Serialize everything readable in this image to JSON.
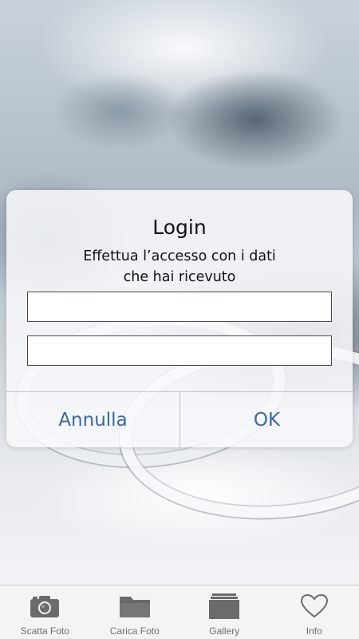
{
  "dialog": {
    "title": "Login",
    "message_line1": "Effettua l’accesso con i dati",
    "message_line2": "che hai ricevuto",
    "field1_value": "",
    "field2_value": "",
    "cancel_label": "Annulla",
    "ok_label": "OK"
  },
  "tabbar": {
    "tabs": [
      {
        "label": "Scatta Foto",
        "icon": "camera-icon"
      },
      {
        "label": "Carica Foto",
        "icon": "folder-icon"
      },
      {
        "label": "Gallery",
        "icon": "gallery-icon"
      },
      {
        "label": "Info",
        "icon": "heart-icon"
      }
    ]
  },
  "colors": {
    "accent": "#3a68a4",
    "tab_icon": "#6b6b6b",
    "tab_label": "#6e6e6e"
  }
}
